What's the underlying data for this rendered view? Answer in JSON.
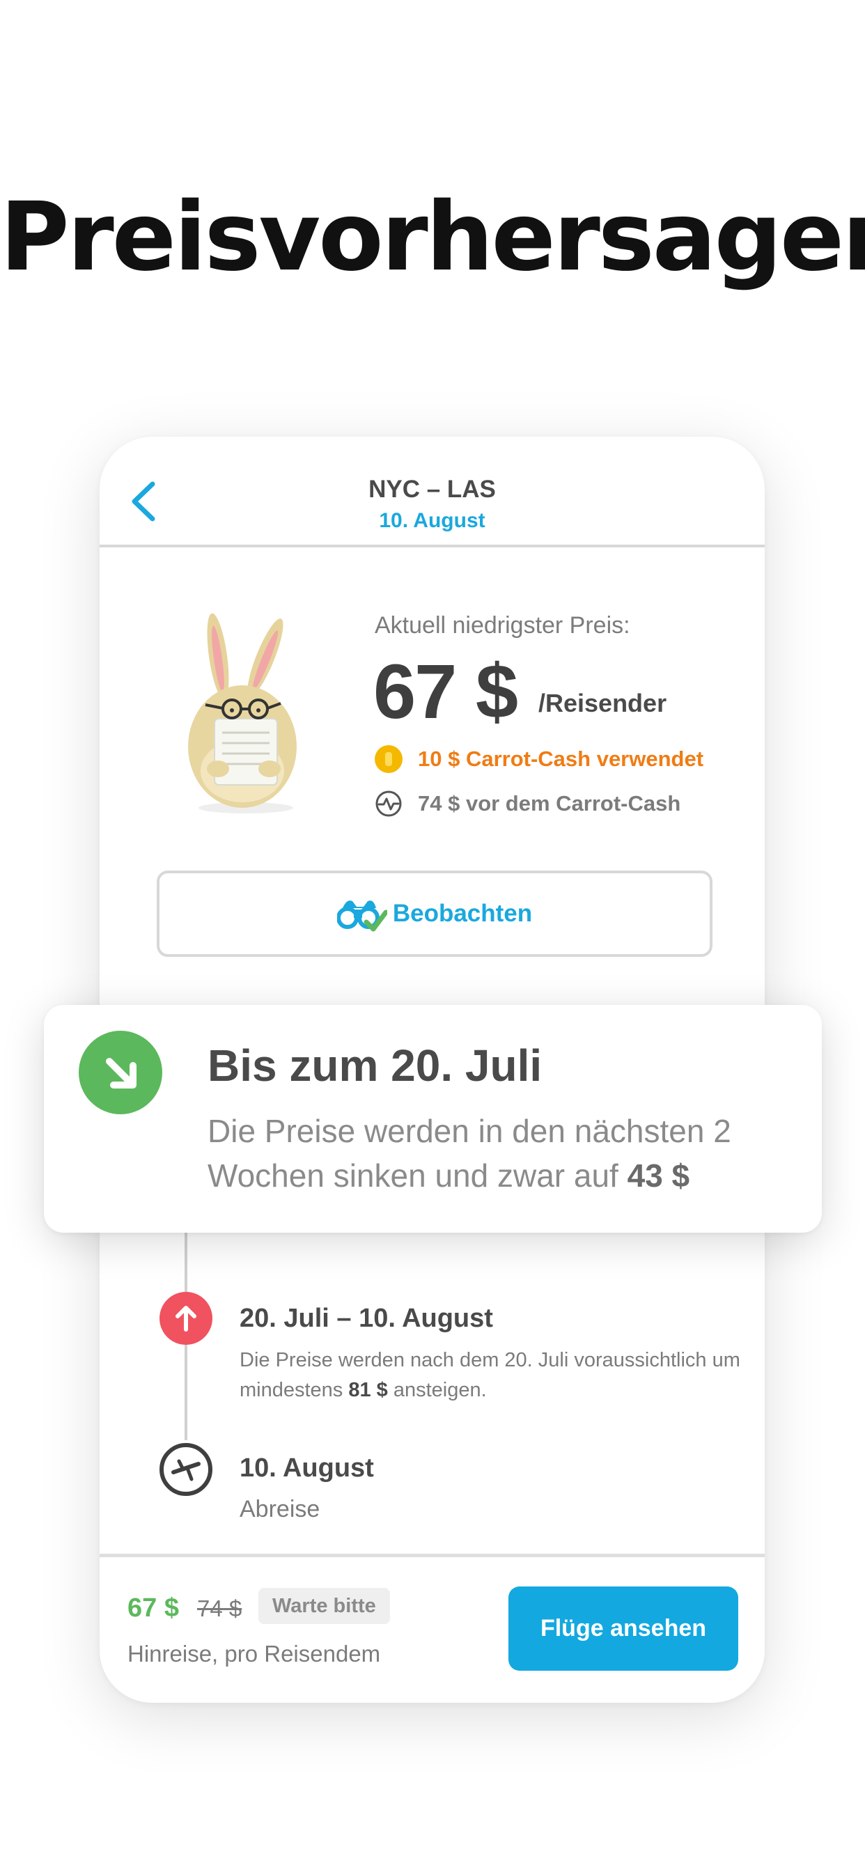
{
  "headline": "Preisvorhersagen",
  "nav": {
    "route": "NYC – LAS",
    "date": "10. August"
  },
  "price": {
    "label": "Aktuell niedrigster Preis:",
    "value": "67 $",
    "per": "/Reisender",
    "carrot_cash": "10 $ Carrot-Cash verwendet",
    "before_carrot_cash": "74 $ vor dem Carrot-Cash"
  },
  "watch_button": {
    "label": "Beobachten"
  },
  "prediction": {
    "title": "Bis zum 20. Juli",
    "body_prefix": "Die Preise werden in den nächsten 2 Wochen sinken und zwar auf ",
    "body_amount": "43 $"
  },
  "timeline": [
    {
      "title": "20. Juli – 10. August",
      "body_prefix": "Die Preise werden nach dem 20. Juli voraussichtlich um mindestens ",
      "body_amount": "81 $",
      "body_suffix": " ansteigen."
    },
    {
      "title": "10. August",
      "subtitle": "Abreise"
    }
  ],
  "footer": {
    "price": "67 $",
    "old_price": "74 $",
    "badge": "Warte bitte",
    "subtitle": "Hinreise, pro Reisendem",
    "button": "Flüge ansehen"
  },
  "colors": {
    "accent_blue": "#1aa8de",
    "down_green": "#5cb85c",
    "up_red": "#f0525f",
    "carrot_orange": "#f07c14"
  }
}
